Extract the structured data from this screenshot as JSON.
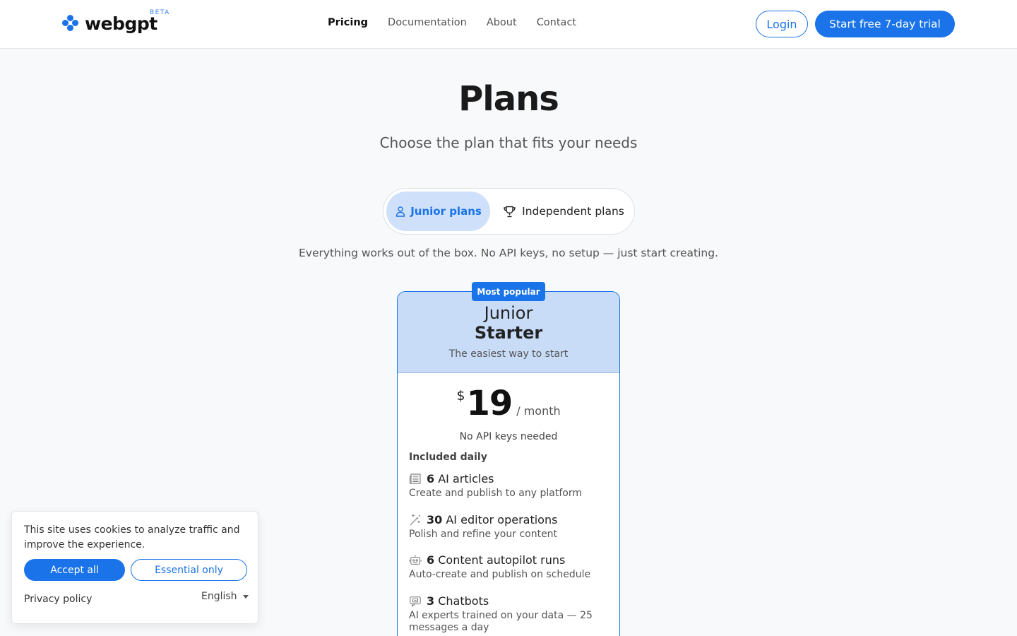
{
  "header": {
    "brand": "webgpt",
    "beta": "BETA",
    "nav": [
      {
        "label": "Pricing",
        "active": true
      },
      {
        "label": "Documentation",
        "active": false
      },
      {
        "label": "About",
        "active": false
      },
      {
        "label": "Contact",
        "active": false
      }
    ],
    "login_label": "Login",
    "trial_label": "Start free 7-day trial"
  },
  "hero": {
    "title": "Plans",
    "subtitle": "Choose the plan that fits your needs"
  },
  "toggle": {
    "junior_label": "Junior plans",
    "independent_label": "Independent plans",
    "selected": "Junior plans"
  },
  "tagline": "Everything works out of the box. No API keys, no setup — just start creating.",
  "plan": {
    "badge": "Most popular",
    "tier": "Junior",
    "name": "Starter",
    "description": "The easiest way to start",
    "currency": "$",
    "price": "19",
    "period": "/ month",
    "note": "No API keys needed",
    "included_heading": "Included daily",
    "features": [
      {
        "count": "6",
        "label": "AI articles",
        "sub": "Create and publish to any platform",
        "icon": "newspaper-icon"
      },
      {
        "count": "30",
        "label": "AI editor operations",
        "sub": "Polish and refine your content",
        "icon": "magic-wand-icon"
      },
      {
        "count": "6",
        "label": "Content autopilot runs",
        "sub": "Auto-create and publish on schedule",
        "icon": "robot-icon"
      },
      {
        "count": "3",
        "label": "Chatbots",
        "sub": "AI experts trained on your data — 25 messages a day",
        "icon": "chatbot-icon"
      }
    ]
  },
  "cookie": {
    "text": "This site uses cookies to analyze traffic and improve the experience.",
    "accept_label": "Accept all",
    "essential_label": "Essential only",
    "privacy_label": "Privacy policy",
    "language": "English"
  },
  "colors": {
    "accent": "#1a73e8",
    "card_header": "#c8dcf8",
    "toggle_active": "#cfe0fa"
  }
}
